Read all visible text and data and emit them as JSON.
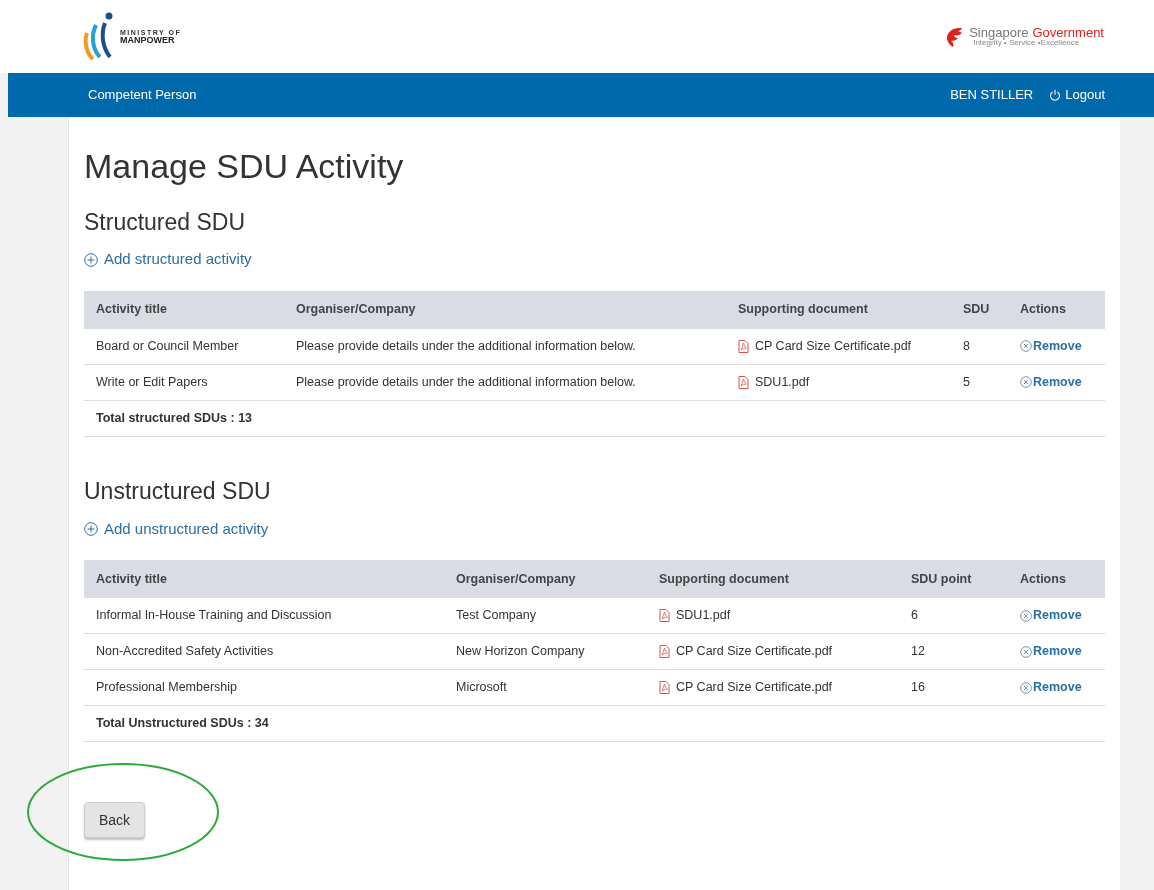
{
  "header": {
    "ministry_logo": {
      "line_1": "MINISTRY OF",
      "line_2": "MANPOWER"
    },
    "gov_logo": {
      "word_1": "Singapore",
      "word_2": "Government",
      "tagline": "Integrity • Service •Excellence"
    }
  },
  "nav_bar": {
    "title": "Competent Person",
    "user": "BEN STILLER",
    "logout": "Logout"
  },
  "page_title": "Manage SDU Activity",
  "sections": [
    {
      "heading": "Structured SDU",
      "add_link": "Add structured activity",
      "columns": [
        "Activity title",
        "Organiser/Company",
        "Supporting document",
        "SDU",
        "Actions"
      ],
      "rows": [
        {
          "title": "Board or Council Member",
          "organiser": "Please provide details under the additional information below.",
          "document": "CP Card Size Certificate.pdf",
          "sdu": "8",
          "action": "Remove"
        },
        {
          "title": "Write or Edit Papers",
          "organiser": "Please provide details under the additional information below.",
          "document": "SDU1.pdf",
          "sdu": "5",
          "action": "Remove"
        }
      ],
      "total": "Total structured SDUs : 13"
    },
    {
      "heading": "Unstructured SDU",
      "add_link": "Add unstructured activity",
      "columns": [
        "Activity title",
        "Organiser/Company",
        "Supporting document",
        "SDU point",
        "Actions"
      ],
      "rows": [
        {
          "title": "Informal In-House Training and Discussion",
          "organiser": "Test Company",
          "document": "SDU1.pdf",
          "sdu": "6",
          "action": "Remove"
        },
        {
          "title": "Non-Accredited Safety Activities",
          "organiser": "New Horizon Company",
          "document": "CP Card Size Certificate.pdf",
          "sdu": "12",
          "action": "Remove"
        },
        {
          "title": "Professional Membership",
          "organiser": "Microsoft",
          "document": "CP Card Size Certificate.pdf",
          "sdu": "16",
          "action": "Remove"
        }
      ],
      "total": "Total Unstructured SDUs : 34"
    }
  ],
  "back_button": "Back"
}
